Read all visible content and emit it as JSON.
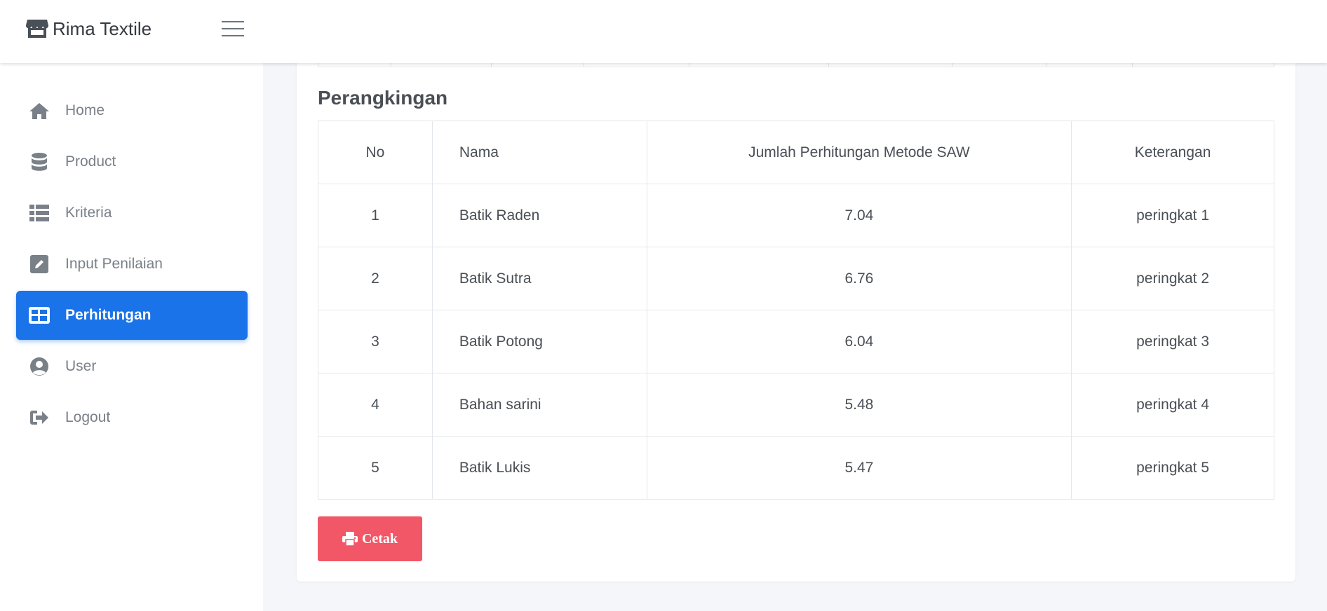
{
  "brand": {
    "title": "Rima Textile",
    "icon": "store-icon"
  },
  "sidebar": {
    "items": [
      {
        "label": "Home",
        "icon": "home-icon",
        "active": false
      },
      {
        "label": "Product",
        "icon": "database-icon",
        "active": false
      },
      {
        "label": "Kriteria",
        "icon": "list-icon",
        "active": false
      },
      {
        "label": "Input Penilaian",
        "icon": "edit-icon",
        "active": false
      },
      {
        "label": "Perhitungan",
        "icon": "table-icon",
        "active": true
      },
      {
        "label": "User",
        "icon": "user-circle-icon",
        "active": false
      },
      {
        "label": "Logout",
        "icon": "logout-icon",
        "active": false
      }
    ]
  },
  "main": {
    "section_title": "Perangkingan",
    "table": {
      "headers": [
        "No",
        "Nama",
        "Jumlah Perhitungan Metode SAW",
        "Keterangan"
      ],
      "rows": [
        [
          "1",
          "Batik Raden",
          "7.04",
          "peringkat 1"
        ],
        [
          "2",
          "Batik Sutra",
          "6.76",
          "peringkat 2"
        ],
        [
          "3",
          "Batik Potong",
          "6.04",
          "peringkat 3"
        ],
        [
          "4",
          "Bahan sarini",
          "5.48",
          "peringkat 4"
        ],
        [
          "5",
          "Batik Lukis",
          "5.47",
          "peringkat 5"
        ]
      ]
    },
    "print_button": {
      "label": "Cetak",
      "icon": "print-icon"
    }
  },
  "colors": {
    "accent": "#1a73e8",
    "danger": "#f25767",
    "background": "#f5f6fa"
  }
}
